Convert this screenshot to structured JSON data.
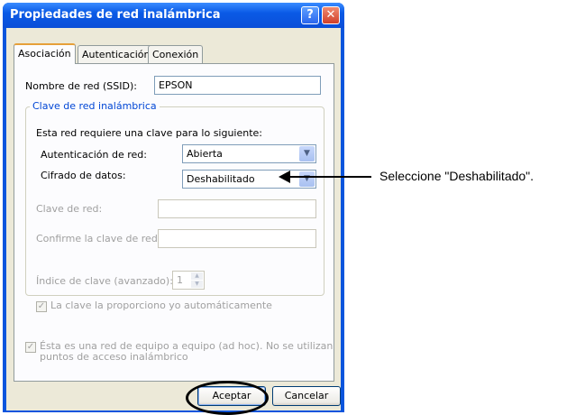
{
  "window": {
    "title": "Propiedades de red inalámbrica",
    "help_glyph": "?",
    "close_glyph": "✕"
  },
  "tabs": [
    {
      "label": "Asociación",
      "active": true
    },
    {
      "label": "Autenticación",
      "active": false
    },
    {
      "label": "Conexión",
      "active": false
    }
  ],
  "association": {
    "ssid_label": "Nombre de red (SSID):",
    "ssid_value": "EPSON",
    "group_legend": "Clave de red inalámbrica",
    "requirement_text": "Esta red requiere una clave para lo siguiente:",
    "auth_label": "Autenticación de red:",
    "auth_value": "Abierta",
    "encryption_label": "Cifrado de datos:",
    "encryption_value": "Deshabilitado",
    "key_label": "Clave de red:",
    "key_value": "",
    "confirm_label": "Confirme la clave de red:",
    "confirm_value": "",
    "index_label": "Índice de clave (avanzado):",
    "index_value": "1",
    "auto_key_label": "La clave la proporciono yo automáticamente",
    "adhoc_label_line1": "Ésta es una red de equipo a equipo (ad hoc). No se utilizan",
    "adhoc_label_line2": "puntos de acceso inalámbrico"
  },
  "buttons": {
    "ok": "Aceptar",
    "cancel": "Cancelar"
  },
  "annotation": {
    "callout_text": "Seleccione \"Deshabilitado\"."
  },
  "colors": {
    "titlebar": "#0a55dd",
    "dialog_bg": "#ece9d8",
    "group_legend": "#0046d5"
  }
}
